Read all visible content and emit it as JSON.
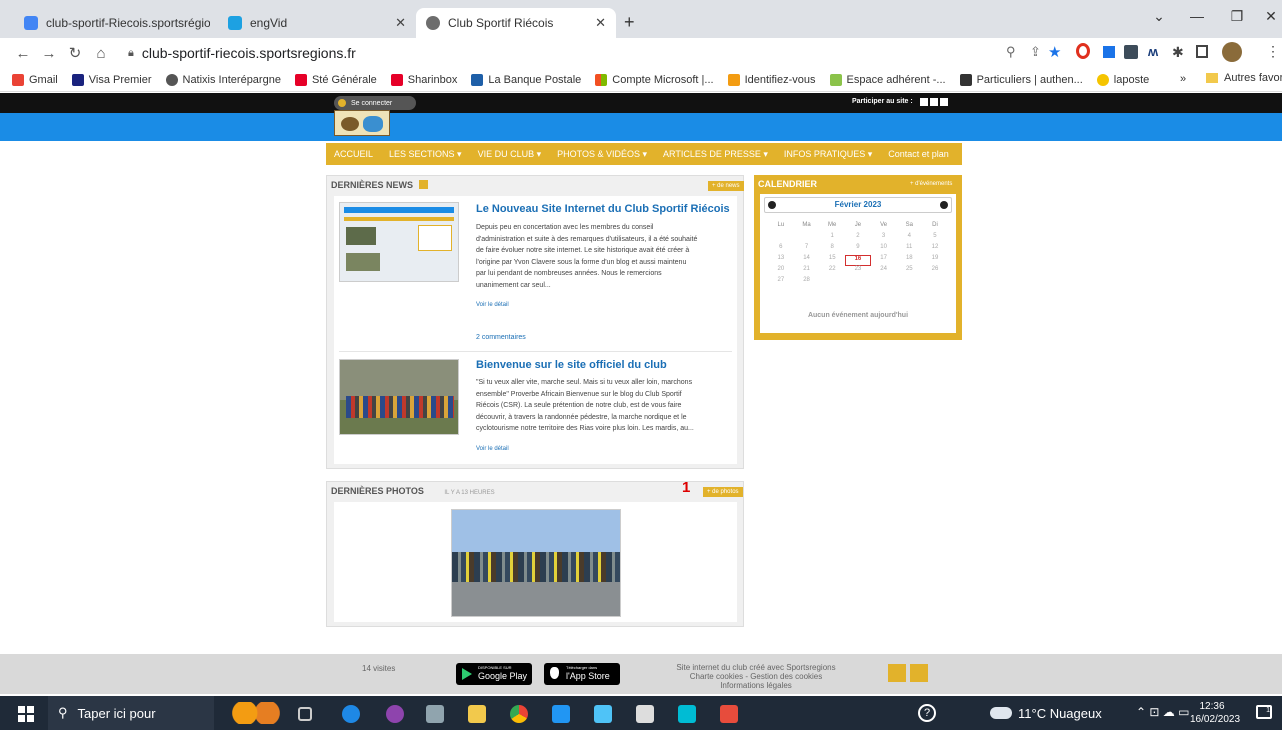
{
  "browser": {
    "tabs": [
      {
        "title": "club-sportif-Riecois.sportsrégion",
        "active": false
      },
      {
        "title": "engVid",
        "active": false
      },
      {
        "title": "Club Sportif Riécois",
        "active": true
      }
    ],
    "new_tab": "+",
    "url": "club-sportif-riecois.sportsregions.fr",
    "bookmarks": [
      {
        "label": "Gmail",
        "color": "#ea4335"
      },
      {
        "label": "Visa Premier",
        "color": "#1a237e"
      },
      {
        "label": "Natixis Interépargne",
        "color": "#555555"
      },
      {
        "label": "Sté Générale",
        "color": "#e60028"
      },
      {
        "label": "Sharinbox",
        "color": "#e60028"
      },
      {
        "label": "La Banque Postale",
        "color": "#1e5fa8"
      },
      {
        "label": "Compte Microsoft |...",
        "color": "#f25022"
      },
      {
        "label": "Identifiez-vous",
        "color": "#f39c12"
      },
      {
        "label": "Espace adhérent -...",
        "color": "#8bc34a"
      },
      {
        "label": "Particuliers | authen...",
        "color": "#333333"
      },
      {
        "label": "laposte",
        "color": "#f5c400"
      }
    ],
    "bookmarks_overflow": "»",
    "other_bookmarks": "Autres favoris"
  },
  "site": {
    "login": "Se connecter",
    "participate": "Participer au site :",
    "nav": [
      "ACCUEIL",
      "LES SECTIONS ▾",
      "VIE DU CLUB ▾",
      "PHOTOS & VIDÉOS ▾",
      "ARTICLES DE PRESSE ▾",
      "INFOS PRATIQUES ▾",
      "Contact et plan"
    ],
    "news": {
      "heading": "DERNIÈRES NEWS",
      "more": "+ de news",
      "items": [
        {
          "title": "Le Nouveau Site Internet du Club Sportif Riécois",
          "lines": [
            "Depuis peu en concertation avec les membres du conseil",
            "d'administration et suite à des remarques d'utilisateurs, il a été souhaité",
            "de faire évoluer notre site internet. Le site historique avait été créer à",
            "l'origine par Yvon Clavere  sous la forme d'un blog et aussi maintenu",
            "par lui pendant de nombreuses années. Nous le remercions",
            "unanimement  car seul..."
          ],
          "detail": "Voir le détail",
          "comments": "2 commentaires"
        },
        {
          "title": "Bienvenue sur le site officiel du club",
          "lines": [
            "\"Si tu veux aller vite, marche seul.  Mais si tu veux aller loin, marchons",
            "ensemble\" Proverbe Africain   Bienvenue sur le blog du Club Sportif",
            "Riécois (CSR). La seule prétention de notre club, est de vous faire",
            "découvrir, à travers la randonnée pédestre, la marche nordique et le",
            "cyclotourisme notre territoire des Rias voire plus loin. Les mardis, au..."
          ],
          "detail": "Voir le détail"
        }
      ]
    },
    "photos": {
      "heading": "DERNIÈRES PHOTOS",
      "age": "IL Y A 13 HEURES",
      "more": "+ de photos",
      "marker": "1"
    },
    "calendar": {
      "heading": "CALENDRIER",
      "more": "+ d'événements",
      "month": "Février 2023",
      "days": [
        "Lu",
        "Ma",
        "Me",
        "Je",
        "Ve",
        "Sa",
        "Di"
      ],
      "weeks": [
        [
          "",
          "",
          "1",
          "2",
          "3",
          "4",
          "5"
        ],
        [
          "6",
          "7",
          "8",
          "9",
          "10",
          "11",
          "12"
        ],
        [
          "13",
          "14",
          "15",
          "16",
          "17",
          "18",
          "19"
        ],
        [
          "20",
          "21",
          "22",
          "23",
          "24",
          "25",
          "26"
        ],
        [
          "27",
          "28",
          "",
          "",
          "",
          "",
          ""
        ]
      ],
      "today": "16",
      "no_events": "Aucun événement aujourd'hui"
    },
    "footer": {
      "visits": "14 visites",
      "google_play_top": "DISPONIBLE SUR",
      "google_play": "Google Play",
      "app_store_top": "Télécharger dans",
      "app_store": "l'App Store",
      "credit_lines": [
        "Site internet du club créé avec Sportsregions",
        "Charte cookies - Gestion des cookies",
        "Informations légales"
      ]
    }
  },
  "taskbar": {
    "search": "Taper ici pour",
    "weather": "11°C Nuageux",
    "time": "12:36",
    "date": "16/02/2023",
    "notifications": "1"
  }
}
